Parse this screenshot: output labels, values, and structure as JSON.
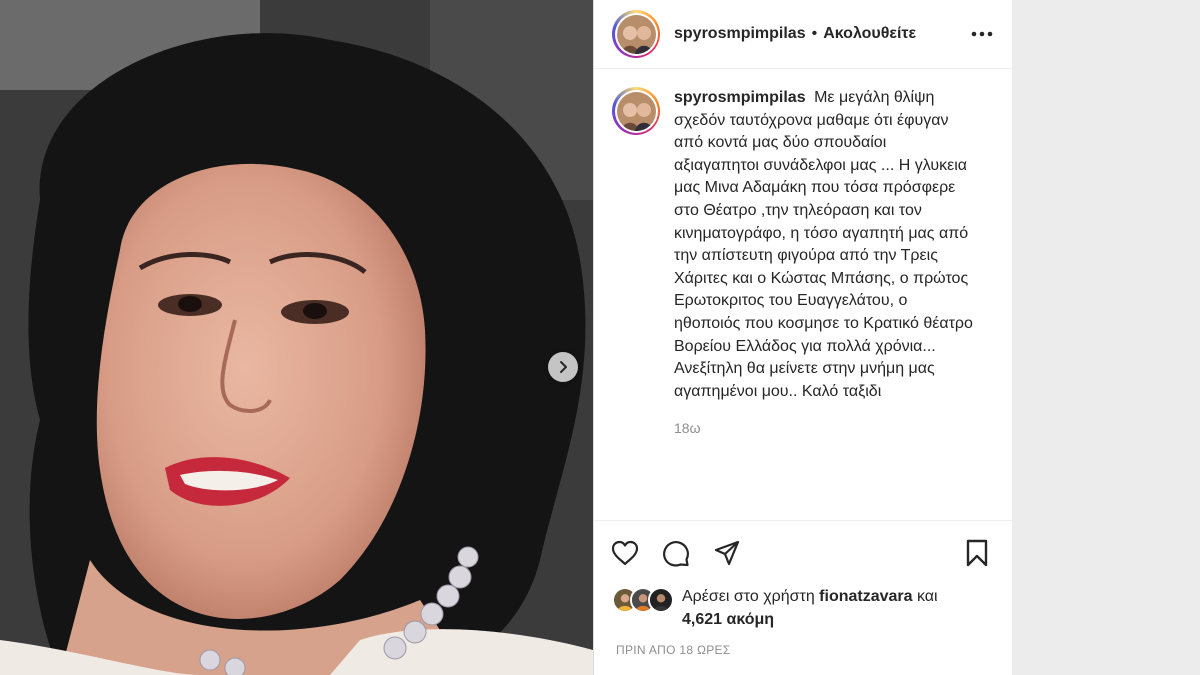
{
  "header": {
    "username": "spyrosmpimpilas",
    "separator": "•",
    "follow_label": "Ακολουθείτε"
  },
  "caption": {
    "username": "spyrosmpimpilas",
    "text": "Με μεγάλη θλίψη σχεδόν ταυτόχρονα μαθαμε ότι έφυγαν από κοντά μας δύο σπουδαίοι αξιαγαπητοι συνάδελφοι μας ... Η γλυκεια μας Μινα Αδαμάκη που τόσα πρόσφερε στο Θέατρο ,την τηλεόραση και τον κινηματογράφο, η τόσο αγαπητή μας από την απίστευτη φιγούρα από την Τρεις Χάριτες και ο Κώστας Μπάσης, ο πρώτος Ερωτοκριτος του Ευαγγελάτου, ο ηθοποιός που κοσμησε το Κρατικό θέατρο Βορείου Ελλάδος για πολλά χρόνια... Ανεξίτηλη θα μείνετε στην μνήμη μας αγαπημένοι μου.. Καλό ταξιδι",
    "time": "18ω"
  },
  "actions": {
    "icons": [
      "heart-icon",
      "comment-icon",
      "share-icon",
      "bookmark-icon"
    ]
  },
  "likes": {
    "prefix": "Αρέσει στο χρήστη",
    "user": "fionatzavara",
    "middle": "και",
    "count": "4,621 ακόμη"
  },
  "post_date": "ΠΡΙΝ ΑΠΟ 18 ΩΡΕΣ",
  "colors": {
    "accent_ring": "#d62976",
    "text": "#262626",
    "muted": "#8e8e8e",
    "page_bg": "#ececec"
  }
}
